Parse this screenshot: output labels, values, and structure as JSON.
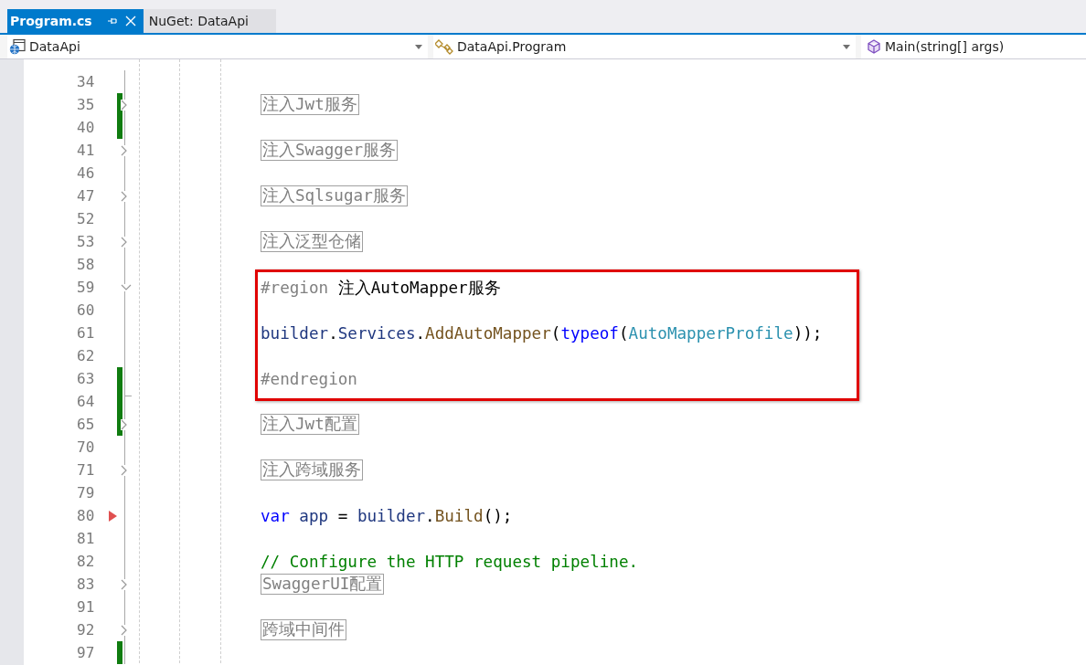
{
  "tabs": [
    {
      "label": "Program.cs",
      "selected": true
    },
    {
      "label": "NuGet: DataApi",
      "selected": false
    }
  ],
  "navigation": [
    {
      "label": "DataApi",
      "kind": "project"
    },
    {
      "label": "DataApi.Program",
      "kind": "class"
    },
    {
      "label": "Main(string[] args)",
      "kind": "method"
    }
  ],
  "blocks": [
    {
      "kind": "plain",
      "lines": [
        {
          "number": "34",
          "kind": "blank",
          "changed": false,
          "flagged": false
        },
        {
          "number": "35",
          "kind": "collapsed",
          "changed": true,
          "flagged": false,
          "region": "注入Jwt服务"
        },
        {
          "number": "40",
          "kind": "blank",
          "changed": true,
          "flagged": false
        },
        {
          "number": "41",
          "kind": "collapsed",
          "changed": false,
          "flagged": false,
          "region": "注入Swagger服务"
        },
        {
          "number": "46",
          "kind": "blank",
          "changed": false,
          "flagged": false
        },
        {
          "number": "47",
          "kind": "collapsed",
          "changed": false,
          "flagged": false,
          "region": "注入Sqlsugar服务"
        },
        {
          "number": "52",
          "kind": "blank",
          "changed": false,
          "flagged": false
        },
        {
          "number": "53",
          "kind": "collapsed",
          "changed": false,
          "flagged": false,
          "region": "注入泛型仓储"
        },
        {
          "number": "58",
          "kind": "blank",
          "changed": false,
          "flagged": false
        }
      ]
    },
    {
      "kind": "highlight",
      "lines": [
        {
          "number": "59",
          "kind": "opening",
          "changed": false,
          "flagged": false,
          "tokens": [
            {
              "kind": "preprocessor",
              "text": "#region"
            },
            {
              "kind": "plain",
              "text": " 注入AutoMapper服务"
            }
          ]
        },
        {
          "number": "60",
          "kind": "blank",
          "changed": false,
          "flagged": false
        },
        {
          "number": "61",
          "kind": "code",
          "changed": false,
          "flagged": false,
          "tokens": [
            {
              "kind": "variable",
              "text": "builder"
            },
            {
              "kind": "plain",
              "text": "."
            },
            {
              "kind": "variable",
              "text": "Services"
            },
            {
              "kind": "plain",
              "text": "."
            },
            {
              "kind": "method",
              "text": "AddAutoMapper"
            },
            {
              "kind": "plain",
              "text": "("
            },
            {
              "kind": "keyword",
              "text": "typeof"
            },
            {
              "kind": "plain",
              "text": "("
            },
            {
              "kind": "type",
              "text": "AutoMapperProfile"
            },
            {
              "kind": "plain",
              "text": "));"
            }
          ]
        },
        {
          "number": "62",
          "kind": "blank",
          "changed": false,
          "flagged": false
        },
        {
          "number": "63",
          "kind": "code",
          "changed": true,
          "flagged": false,
          "tokens": [
            {
              "kind": "preprocessor",
              "text": "#endregion"
            }
          ]
        }
      ]
    },
    {
      "kind": "plain",
      "lines": [
        {
          "number": "64",
          "kind": "closing",
          "changed": true,
          "flagged": false
        },
        {
          "number": "65",
          "kind": "collapsed",
          "changed": true,
          "flagged": false,
          "region": "注入Jwt配置"
        },
        {
          "number": "70",
          "kind": "blank",
          "changed": false,
          "flagged": false
        },
        {
          "number": "71",
          "kind": "collapsed",
          "changed": false,
          "flagged": false,
          "region": "注入跨域服务"
        },
        {
          "number": "79",
          "kind": "blank",
          "changed": false,
          "flagged": false
        },
        {
          "number": "80",
          "kind": "code",
          "changed": false,
          "flagged": true,
          "tokens": [
            {
              "kind": "keyword",
              "text": "var"
            },
            {
              "kind": "variable",
              "text": " app"
            },
            {
              "kind": "plain",
              "text": " = "
            },
            {
              "kind": "variable",
              "text": "builder"
            },
            {
              "kind": "plain",
              "text": "."
            },
            {
              "kind": "method",
              "text": "Build"
            },
            {
              "kind": "plain",
              "text": "();"
            }
          ]
        },
        {
          "number": "81",
          "kind": "blank",
          "changed": false,
          "flagged": false
        },
        {
          "number": "82",
          "kind": "code",
          "changed": false,
          "flagged": false,
          "tokens": [
            {
              "kind": "comment",
              "text": "// Configure the HTTP request pipeline."
            }
          ]
        },
        {
          "number": "83",
          "kind": "collapsed",
          "changed": false,
          "flagged": false,
          "region": "SwaggerUI配置"
        },
        {
          "number": "91",
          "kind": "blank",
          "changed": false,
          "flagged": false
        },
        {
          "number": "92",
          "kind": "collapsed",
          "changed": false,
          "flagged": false,
          "region": "跨域中间件"
        },
        {
          "number": "97",
          "kind": "blank",
          "changed": true,
          "flagged": false
        }
      ]
    }
  ]
}
